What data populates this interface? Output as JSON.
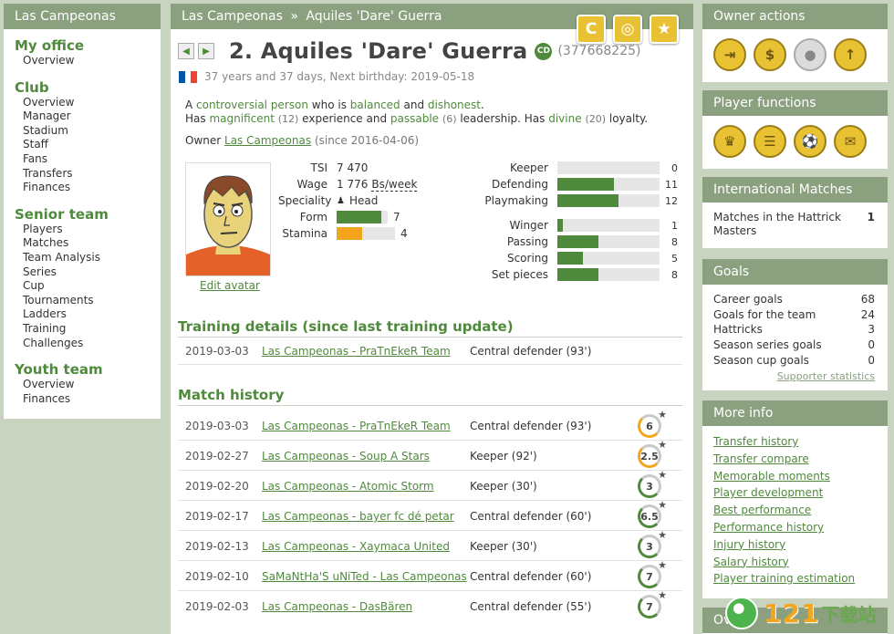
{
  "left": {
    "title": "Las Campeonas",
    "sections": [
      {
        "heading": "My office",
        "items": [
          "Overview"
        ]
      },
      {
        "heading": "Club",
        "items": [
          "Overview",
          "Manager",
          "Stadium",
          "Staff",
          "Fans",
          "Transfers",
          "Finances"
        ]
      },
      {
        "heading": "Senior team",
        "items": [
          "Players",
          "Matches",
          "Team Analysis",
          "Series",
          "Cup",
          "Tournaments",
          "Ladders",
          "Training",
          "Challenges"
        ]
      },
      {
        "heading": "Youth team",
        "items": [
          "Overview",
          "Finances"
        ]
      }
    ]
  },
  "main": {
    "breadcrumb_team": "Las Campeonas",
    "breadcrumb_sep": "»",
    "breadcrumb_player": "Aquiles 'Dare' Guerra",
    "header_icons": [
      {
        "icon": "captain-c-icon",
        "glyph": "C"
      },
      {
        "icon": "binoculars-icon",
        "glyph": "◎"
      },
      {
        "icon": "star-icon",
        "glyph": "★"
      }
    ],
    "prev_glyph": "◀",
    "next_glyph": "▶",
    "player_title": "2. Aquiles 'Dare' Guerra",
    "cd_badge": "CD",
    "player_id": "(377668225)",
    "flag_colors": [
      "#0055a4",
      "#ffffff",
      "#ef4135"
    ],
    "age_text": "37 years and 37 days, Next birthday: 2019-05-18",
    "desc": {
      "l1_a": "A",
      "l1_b": "controversial person",
      "l1_c": "who is",
      "l1_d": "balanced",
      "l1_e": "and",
      "l1_f": "dishonest",
      "l1_g": ".",
      "l2_a": "Has",
      "l2_b": "magnificent",
      "l2_c": "(12)",
      "l2_d": "experience and",
      "l2_e": "passable",
      "l2_f": "(6)",
      "l2_g": "leadership. Has",
      "l2_h": "divine",
      "l2_i": "(20)",
      "l2_j": "loyalty."
    },
    "owner_label": "Owner",
    "owner_team": "Las Campeonas",
    "owner_since": "(since 2016-04-06)",
    "edit_avatar": "Edit avatar",
    "info": {
      "tsi_label": "TSI",
      "tsi_value": "7 470",
      "wage_label": "Wage",
      "wage_value": "1 776",
      "wage_unit": "Bs/week",
      "speciality_label": "Speciality",
      "speciality_icon": "♟",
      "speciality_value": "Head",
      "form_label": "Form",
      "form_value": "7",
      "form_fraction": 0.875,
      "stamina_label": "Stamina",
      "stamina_value": "4",
      "stamina_fraction": 0.44
    },
    "skills": [
      {
        "name": "Keeper",
        "value": "0",
        "fraction": 0.0
      },
      {
        "name": "Defending",
        "value": "11",
        "fraction": 0.55
      },
      {
        "name": "Playmaking",
        "value": "12",
        "fraction": 0.6
      },
      {
        "name": "Winger",
        "value": "1",
        "fraction": 0.05
      },
      {
        "name": "Passing",
        "value": "8",
        "fraction": 0.4
      },
      {
        "name": "Scoring",
        "value": "5",
        "fraction": 0.25
      },
      {
        "name": "Set pieces",
        "value": "8",
        "fraction": 0.4
      }
    ],
    "training_title": "Training details (since last training update)",
    "training": {
      "date": "2019-03-03",
      "match": "Las Campeonas - PraTnEkeR Team",
      "position": "Central defender (93')"
    },
    "history_title": "Match history",
    "history": [
      {
        "date": "2019-03-03",
        "match": "Las Campeonas - PraTnEkeR Team",
        "position": "Central defender (93')",
        "rating": "6",
        "style": "o"
      },
      {
        "date": "2019-02-27",
        "match": "Las Campeonas - Soup A Stars",
        "position": "Keeper  (92')",
        "rating": "2.5",
        "style": "o"
      },
      {
        "date": "2019-02-20",
        "match": "Las Campeonas - Atomic Storm",
        "position": "Keeper  (30')",
        "rating": "3",
        "style": "g"
      },
      {
        "date": "2019-02-17",
        "match": "Las Campeonas - bayer fc dé petar",
        "position": "Central defender (60')",
        "rating": "6.5",
        "style": "g"
      },
      {
        "date": "2019-02-13",
        "match": "Las Campeonas - Xaymaca United",
        "position": "Keeper  (30')",
        "rating": "3",
        "style": "g"
      },
      {
        "date": "2019-02-10",
        "match": "SaMaNtHa'S uNiTed - Las Campeonas",
        "position": "Central defender (60')",
        "rating": "7",
        "style": "g"
      },
      {
        "date": "2019-02-03",
        "match": "Las Campeonas - DasBären",
        "position": "Central defender (55')",
        "rating": "7",
        "style": "g"
      }
    ]
  },
  "right": {
    "owner_actions_title": "Owner actions",
    "owner_actions": [
      {
        "icon": "exit-door-icon",
        "glyph": "⇥",
        "gray": false
      },
      {
        "icon": "money-sell-icon",
        "glyph": "$",
        "gray": false
      },
      {
        "icon": "youth-ball-icon",
        "glyph": "●",
        "gray": true
      },
      {
        "icon": "promote-icon",
        "glyph": "↑",
        "gray": false
      }
    ],
    "player_functions_title": "Player functions",
    "player_functions": [
      {
        "icon": "crown-icon",
        "glyph": "♛",
        "gray": false
      },
      {
        "icon": "notepad-icon",
        "glyph": "☰",
        "gray": false
      },
      {
        "icon": "football-icon",
        "glyph": "⚽",
        "gray": false
      },
      {
        "icon": "speech-bubble-icon",
        "glyph": "✉",
        "gray": false
      }
    ],
    "international_title": "International Matches",
    "international": {
      "label": "Matches in the Hattrick Masters",
      "value": "1"
    },
    "goals_title": "Goals",
    "goals": [
      {
        "label": "Career goals",
        "value": "68"
      },
      {
        "label": "Goals for the team",
        "value": "24"
      },
      {
        "label": "Hattricks",
        "value": "3"
      },
      {
        "label": "Season series goals",
        "value": "0"
      },
      {
        "label": "Season cup goals",
        "value": "0"
      }
    ],
    "supporter_statistics": "Supporter statistics",
    "more_info_title": "More info",
    "more_info": [
      "Transfer history",
      "Transfer compare",
      "Memorable moments",
      "Player development",
      "Best performance",
      "Performance history",
      "Injury history",
      "Salary history",
      "Player training estimation"
    ],
    "next_box_title": "Ov"
  },
  "watermark": {
    "number": "121",
    "text": "下载站"
  }
}
